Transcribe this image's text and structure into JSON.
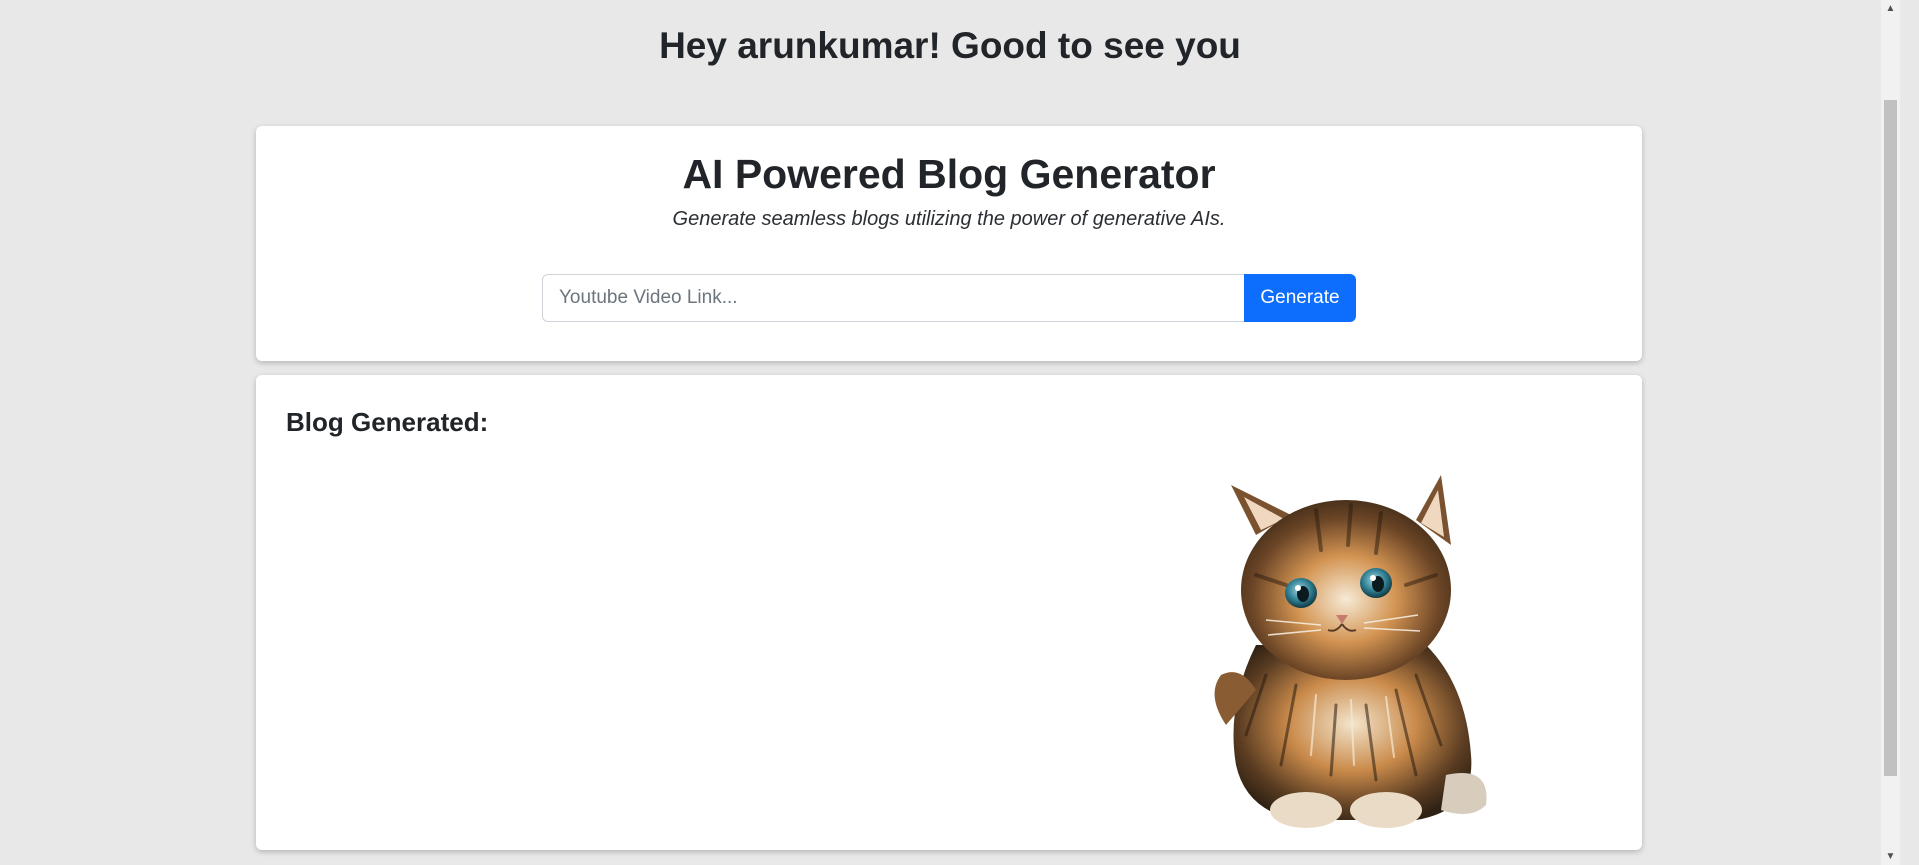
{
  "header": {
    "greeting": "Hey arunkumar! Good to see you"
  },
  "generator": {
    "title": "AI Powered Blog Generator",
    "subtitle": "Generate seamless blogs utilizing the power of generative AIs.",
    "input": {
      "value": "",
      "placeholder": "Youtube Video Link..."
    },
    "generate_label": "Generate"
  },
  "result": {
    "heading": "Blog Generated:",
    "image": "kitten-illustration"
  },
  "colors": {
    "page_bg": "#e8e8e8",
    "card_bg": "#ffffff",
    "primary_button": "#0d6efd",
    "text": "#212529"
  },
  "icons": {
    "scroll_up": "triangle-up-icon",
    "scroll_down": "triangle-down-icon"
  }
}
